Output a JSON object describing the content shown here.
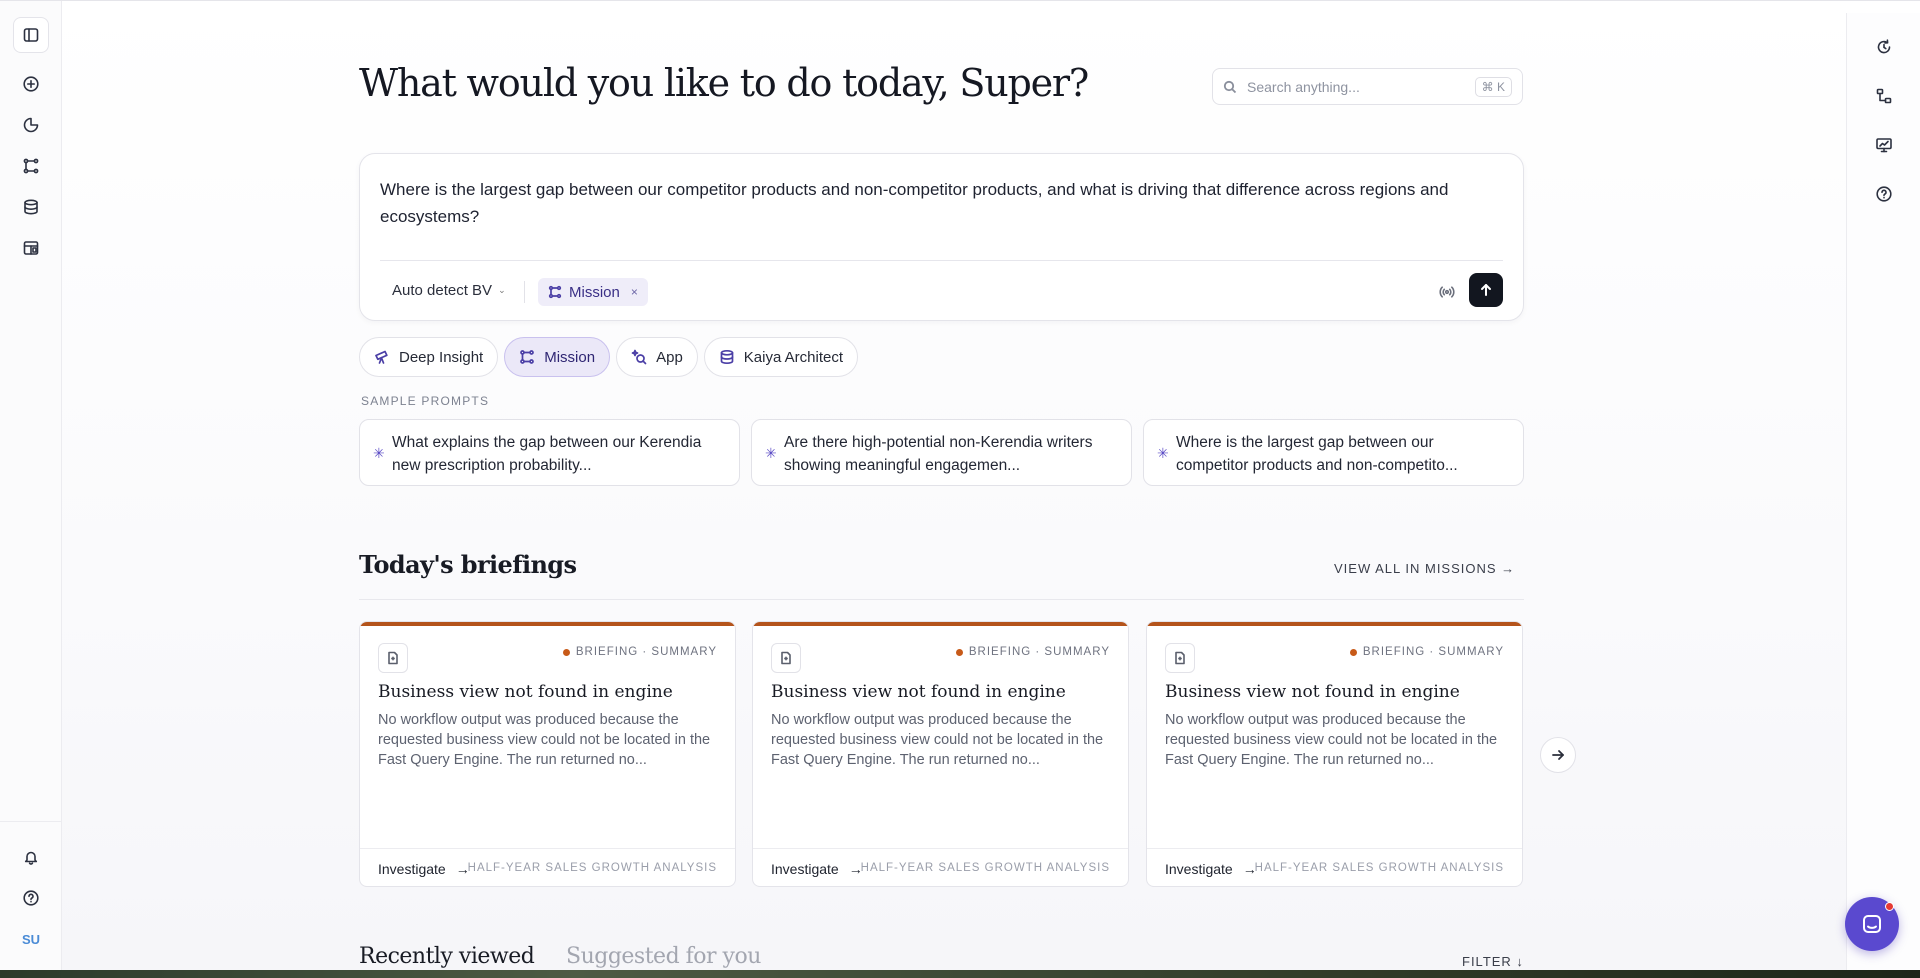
{
  "header": {
    "title": "What would you like to do today, Super?",
    "search_placeholder": "Search anything...",
    "search_shortcut": "⌘ K"
  },
  "composer": {
    "query": "Where is the largest gap between our competitor products and non-competitor products, and what is driving that difference across regions and ecosystems?",
    "bv_select": "Auto detect BV",
    "chip_label": "Mission",
    "chip_close": "×"
  },
  "modes": [
    {
      "label": "Deep Insight",
      "icon": "telescope-icon"
    },
    {
      "label": "Mission",
      "icon": "workflow-icon",
      "active": true
    },
    {
      "label": "App",
      "icon": "sparkle-search-icon"
    },
    {
      "label": "Kaiya Architect",
      "icon": "database-icon"
    }
  ],
  "sample_prompts": {
    "label": "SAMPLE PROMPTS",
    "items": [
      "What explains the gap between our Kerendia new prescription probability...",
      "Are there high-potential non-Kerendia writers showing meaningful engagemen...",
      "Where is the largest gap between our competitor products and non-competito..."
    ]
  },
  "briefings": {
    "title": "Today's briefings",
    "view_all": "VIEW ALL IN MISSIONS →",
    "accent_color": "#b4541b",
    "cards": [
      {
        "tag": "BRIEFING · SUMMARY",
        "title": "Business view not found in engine",
        "body": "No workflow output was produced because the requested business view could not be located in the Fast Query Engine. The run returned no...",
        "investigate": "Investigate",
        "analysis": "HALF-YEAR SALES GROWTH ANALYSIS"
      },
      {
        "tag": "BRIEFING · SUMMARY",
        "title": "Business view not found in engine",
        "body": "No workflow output was produced because the requested business view could not be located in the Fast Query Engine. The run returned no...",
        "investigate": "Investigate",
        "analysis": "HALF-YEAR SALES GROWTH ANALYSIS"
      },
      {
        "tag": "BRIEFING · SUMMARY",
        "title": "Business view not found in engine",
        "body": "No workflow output was produced because the requested business view could not be located in the Fast Query Engine. The run returned no...",
        "investigate": "Investigate",
        "analysis": "HALF-YEAR SALES GROWTH ANALYSIS"
      }
    ]
  },
  "bottom_tabs": {
    "recent": "Recently viewed",
    "suggested": "Suggested for you",
    "filter": "FILTER ↓"
  },
  "sidebar": {
    "user_initials": "SU",
    "icons": [
      "sidebar-toggle-icon",
      "plus-circle-icon",
      "history-icon",
      "workflow-icon",
      "database-icon",
      "layout-icon",
      "bell-icon",
      "help-icon"
    ]
  },
  "right_rail": {
    "icons": [
      "refresh-icon",
      "hierarchy-icon",
      "monitor-chart-icon",
      "help-icon"
    ]
  }
}
